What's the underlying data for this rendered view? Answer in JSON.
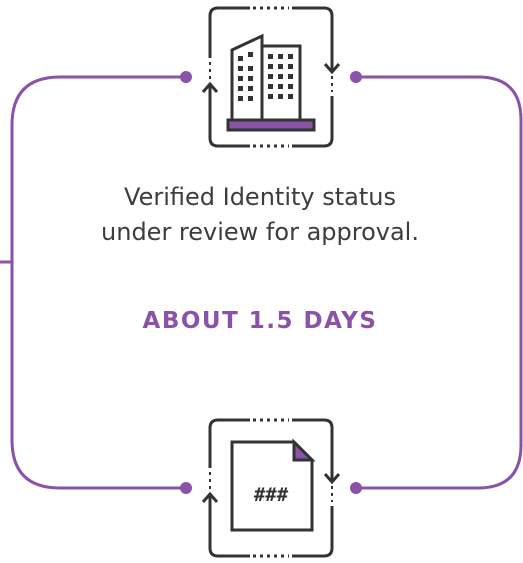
{
  "colors": {
    "accent": "#8a53a8",
    "line": "#333333"
  },
  "top_icon": {
    "icon": "office-building-icon"
  },
  "bottom_icon": {
    "icon": "document-icon",
    "label": "###"
  },
  "status": {
    "line1": "Verified Identity status",
    "line2": "under review for approval."
  },
  "duration": "ABOUT 1.5 DAYS"
}
